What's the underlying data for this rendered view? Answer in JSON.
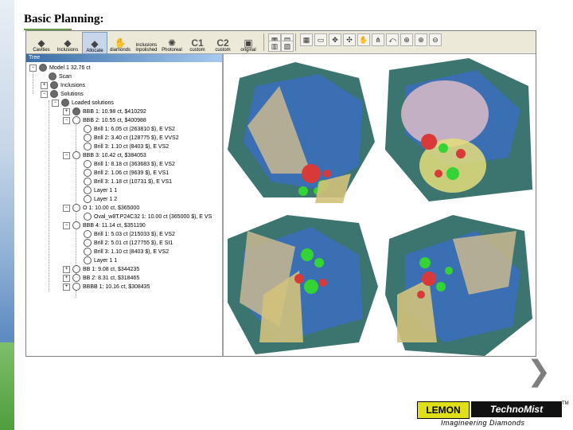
{
  "slide": {
    "title": "Basic Planning:"
  },
  "toolbar": {
    "cavities": "Cavities",
    "inclusions": "Inclusions",
    "allocate": "Allocate",
    "diamonds": "diamonds",
    "inclusions_inpolished_top": "inclusions",
    "inclusions_inpolished_bottom": "inpolished",
    "photoreal": "Photoreal",
    "c1": "C1",
    "c1_label": "custom",
    "c2": "C2",
    "c2_label": "custom",
    "original": "original"
  },
  "tree": {
    "header": "Tree",
    "rows": [
      {
        "text": "Model 1  32.76 ct"
      },
      {
        "text": "Scan"
      },
      {
        "text": "Inclusions"
      },
      {
        "text": "Solutions"
      },
      {
        "text": "Loaded solutions"
      },
      {
        "text": "BBB 1: 10.98 ct,  $410292"
      },
      {
        "text": "BBB 2: 10.55 ct,  $400988"
      },
      {
        "text": "Brill 1: 6.05 ct (263810 $),  E VS2"
      },
      {
        "text": "Brill 2: 3.40 ct (128775 $),  E VVS2"
      },
      {
        "text": "Brill 3: 1.10 ct (8403 $),  E VS2"
      },
      {
        "text": "BBB 3: 10.42 ct,  $384053"
      },
      {
        "text": "Brill 1: 8.18 ct (363683 $),  E VS2"
      },
      {
        "text": "Brill 2: 1.06 ct (9639 $),  E VS1"
      },
      {
        "text": "Brill 3: 1.18 ct (10731 $),  E VS1"
      },
      {
        "text": "Layer 1 1"
      },
      {
        "text": "Layer 1 2"
      },
      {
        "text": "O 1: 10.00 ct,  $365000"
      },
      {
        "text": "Oval_w8T.P24C32 1: 10.00 ct (365000 $),  E VS"
      },
      {
        "text": "BBB 4: 11.14 ct,  $351190"
      },
      {
        "text": "Brill 1: 5.03 ct (215033 $),  E VS2"
      },
      {
        "text": "Brill 2: 5.01 ct (127755 $),  E SI1"
      },
      {
        "text": "Brill 3: 1.10 ct (8403 $),  E VS2"
      },
      {
        "text": "Layer 1 1"
      },
      {
        "text": "BB 1: 9.08 ct,  $344235"
      },
      {
        "text": "BB 2: 8.31 ct,  $318465"
      },
      {
        "text": "BBBB 1: 10.16 ct,  $308435"
      }
    ]
  },
  "logo": {
    "lemon": "LEMON",
    "technomist": "TechnoMist",
    "tm": "TM",
    "tagline": "Imagineering  Diamonds"
  },
  "colors": {
    "stone_body": "#2f6a63",
    "inner_blue": "#3a6fc0",
    "cone": "#c9b98f",
    "inclusion_green": "#33d433",
    "inclusion_red": "#d83a3a",
    "accent_green": "#6a9a4a"
  },
  "icons": {
    "next": "chevron-right-icon"
  }
}
